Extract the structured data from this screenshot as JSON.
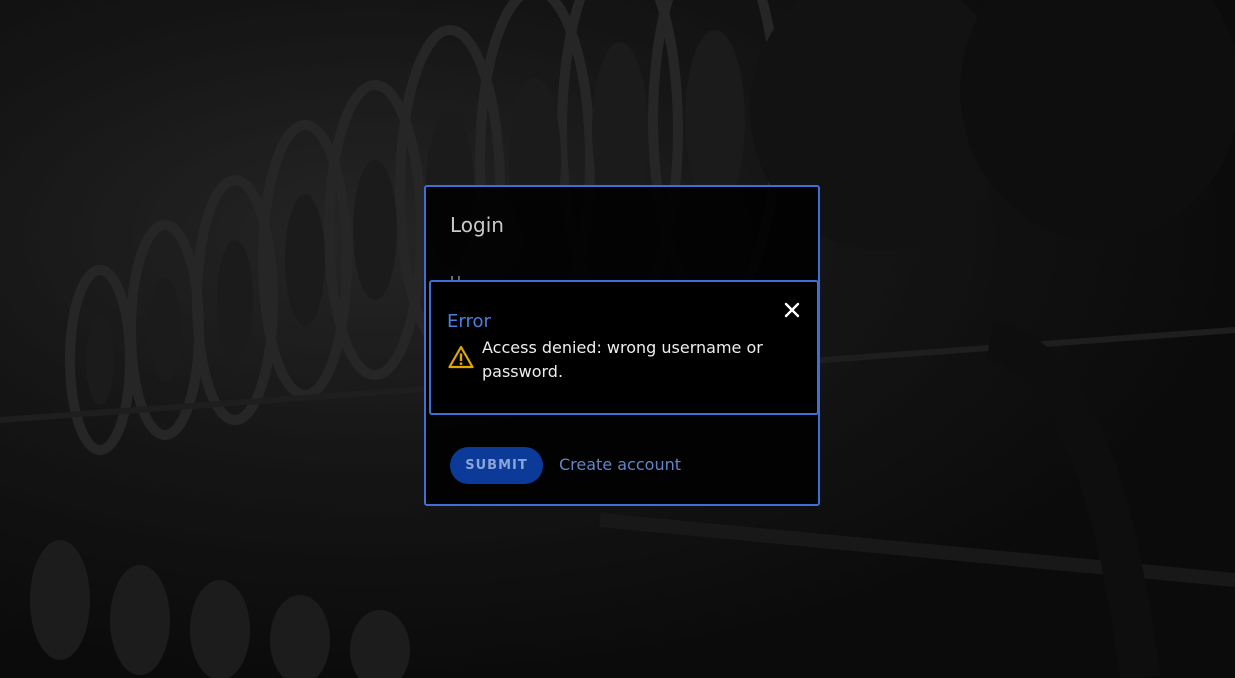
{
  "login": {
    "title": "Login",
    "username_label": "U",
    "submit_label": "SUBMIT",
    "create_account_label": "Create account"
  },
  "error": {
    "title": "Error",
    "message": "Access denied: wrong username or password.",
    "icon": "warning-icon",
    "close_icon": "close-icon"
  },
  "colors": {
    "accent": "#3d6fd6",
    "button_bg": "#0b3a99",
    "warning": "#e0a800"
  }
}
